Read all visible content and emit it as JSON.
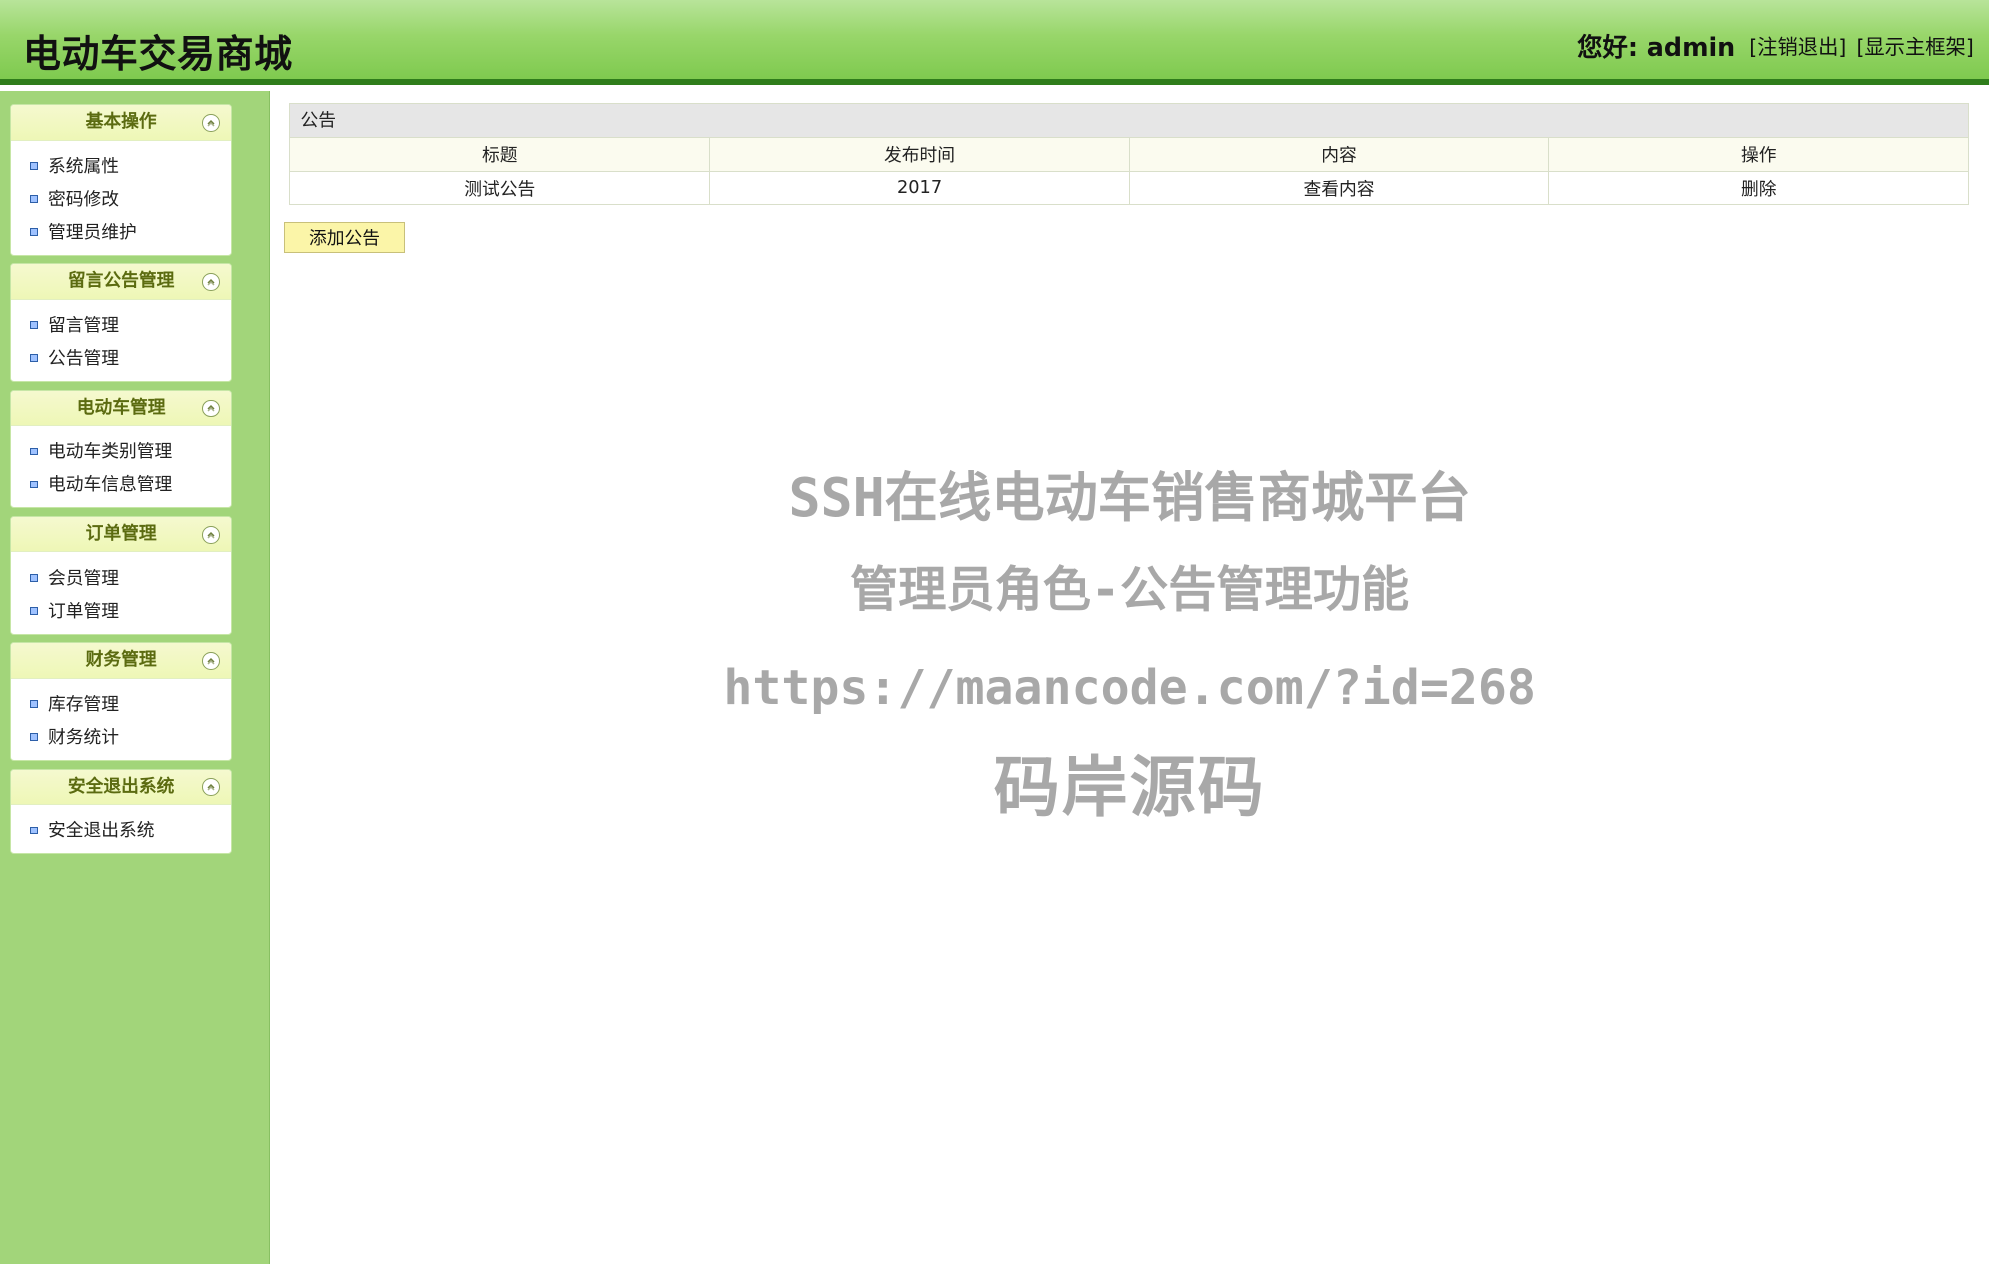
{
  "header": {
    "app_title": "电动车交易商城",
    "greeting": "您好: admin",
    "links": [
      {
        "label": "[注销退出]"
      },
      {
        "label": "[显示主框架]"
      }
    ]
  },
  "sidebar": {
    "sections": [
      {
        "title": "基本操作",
        "items": [
          {
            "label": "系统属性"
          },
          {
            "label": "密码修改"
          },
          {
            "label": "管理员维护"
          }
        ]
      },
      {
        "title": "留言公告管理",
        "items": [
          {
            "label": "留言管理"
          },
          {
            "label": "公告管理"
          }
        ]
      },
      {
        "title": "电动车管理",
        "items": [
          {
            "label": "电动车类别管理"
          },
          {
            "label": "电动车信息管理"
          }
        ]
      },
      {
        "title": "订单管理",
        "items": [
          {
            "label": "会员管理"
          },
          {
            "label": "订单管理"
          }
        ]
      },
      {
        "title": "财务管理",
        "items": [
          {
            "label": "库存管理"
          },
          {
            "label": "财务统计"
          }
        ]
      },
      {
        "title": "安全退出系统",
        "items": [
          {
            "label": "安全退出系统"
          }
        ]
      }
    ]
  },
  "main": {
    "table": {
      "caption": "公告",
      "headers": [
        "标题",
        "发布时间",
        "内容",
        "操作"
      ],
      "rows": [
        {
          "title": "测试公告",
          "published": "2017",
          "content_action": "查看内容",
          "action": "删除"
        }
      ]
    },
    "add_button_label": "添加公告"
  },
  "watermark": {
    "line1": "SSH在线电动车销售商城平台",
    "line2": "管理员角色-公告管理功能",
    "line3": "https://maancode.com/?id=268",
    "line4": "码岸源码"
  },
  "colors": {
    "header_green": "#8fd05f",
    "header_dark_line": "#2f7d1b",
    "sidebar_bg": "#a2d57a",
    "menu_title_bg": "#eef7b6",
    "button_bg": "#fbf5a8",
    "watermark_gray": "#a8a8a8"
  },
  "icons": {
    "menu_collapse": "chevron-up-icon",
    "menu_bullet": "square-bullet-icon"
  }
}
